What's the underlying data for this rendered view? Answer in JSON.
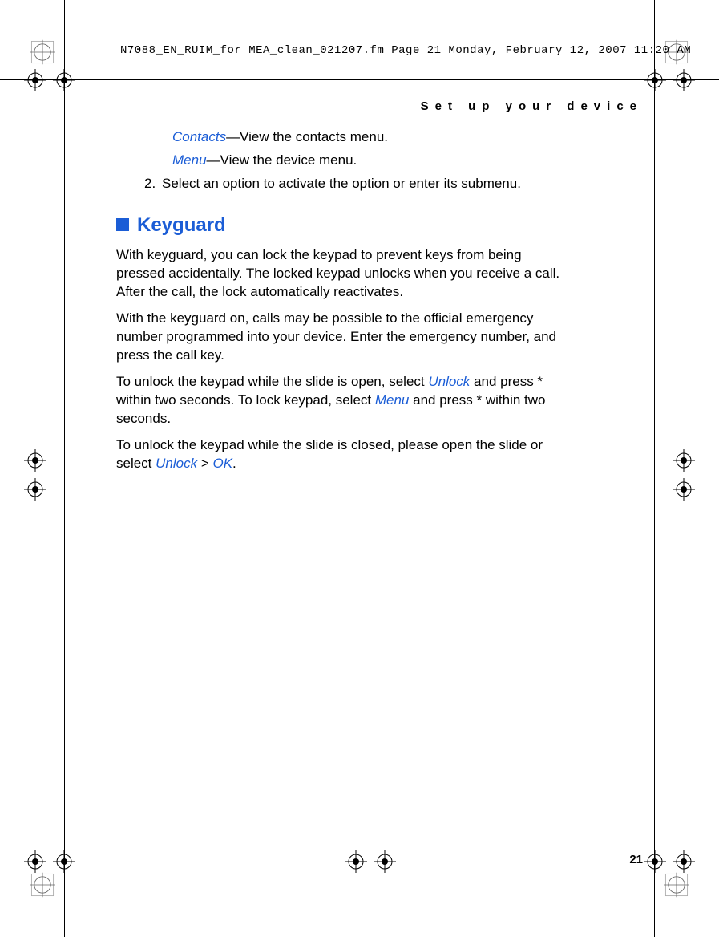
{
  "header_line": "N7088_EN_RUIM_for MEA_clean_021207.fm  Page 21  Monday, February 12, 2007  11:20 AM",
  "running_head": "Set up your device",
  "contacts_label": "Contacts",
  "contacts_desc": "—View the contacts menu.",
  "menu_label": "Menu",
  "menu_desc": "—View the device menu.",
  "step2_num": "2.",
  "step2_text": "Select an option to activate the option or enter its submenu.",
  "section_title": "Keyguard",
  "p1": "With keyguard, you can lock the keypad to prevent keys from being pressed accidentally. The locked keypad unlocks when you receive a call. After the call, the lock automatically reactivates.",
  "p2": "With the keyguard on, calls may be possible to the official emergency number programmed into your device. Enter the emergency number, and press the call key.",
  "p3a": "To unlock the keypad while the slide is open, select ",
  "p3_unlock": "Unlock",
  "p3b": " and press * within two seconds. To lock keypad, select ",
  "p3_menu": "Menu",
  "p3c": " and press * within two seconds.",
  "p4a": "To unlock the keypad while the slide is closed, please open the slide or select ",
  "p4_unlock": "Unlock",
  "p4_gt": " > ",
  "p4_ok": "OK",
  "p4_dot": ".",
  "page_number": "21"
}
